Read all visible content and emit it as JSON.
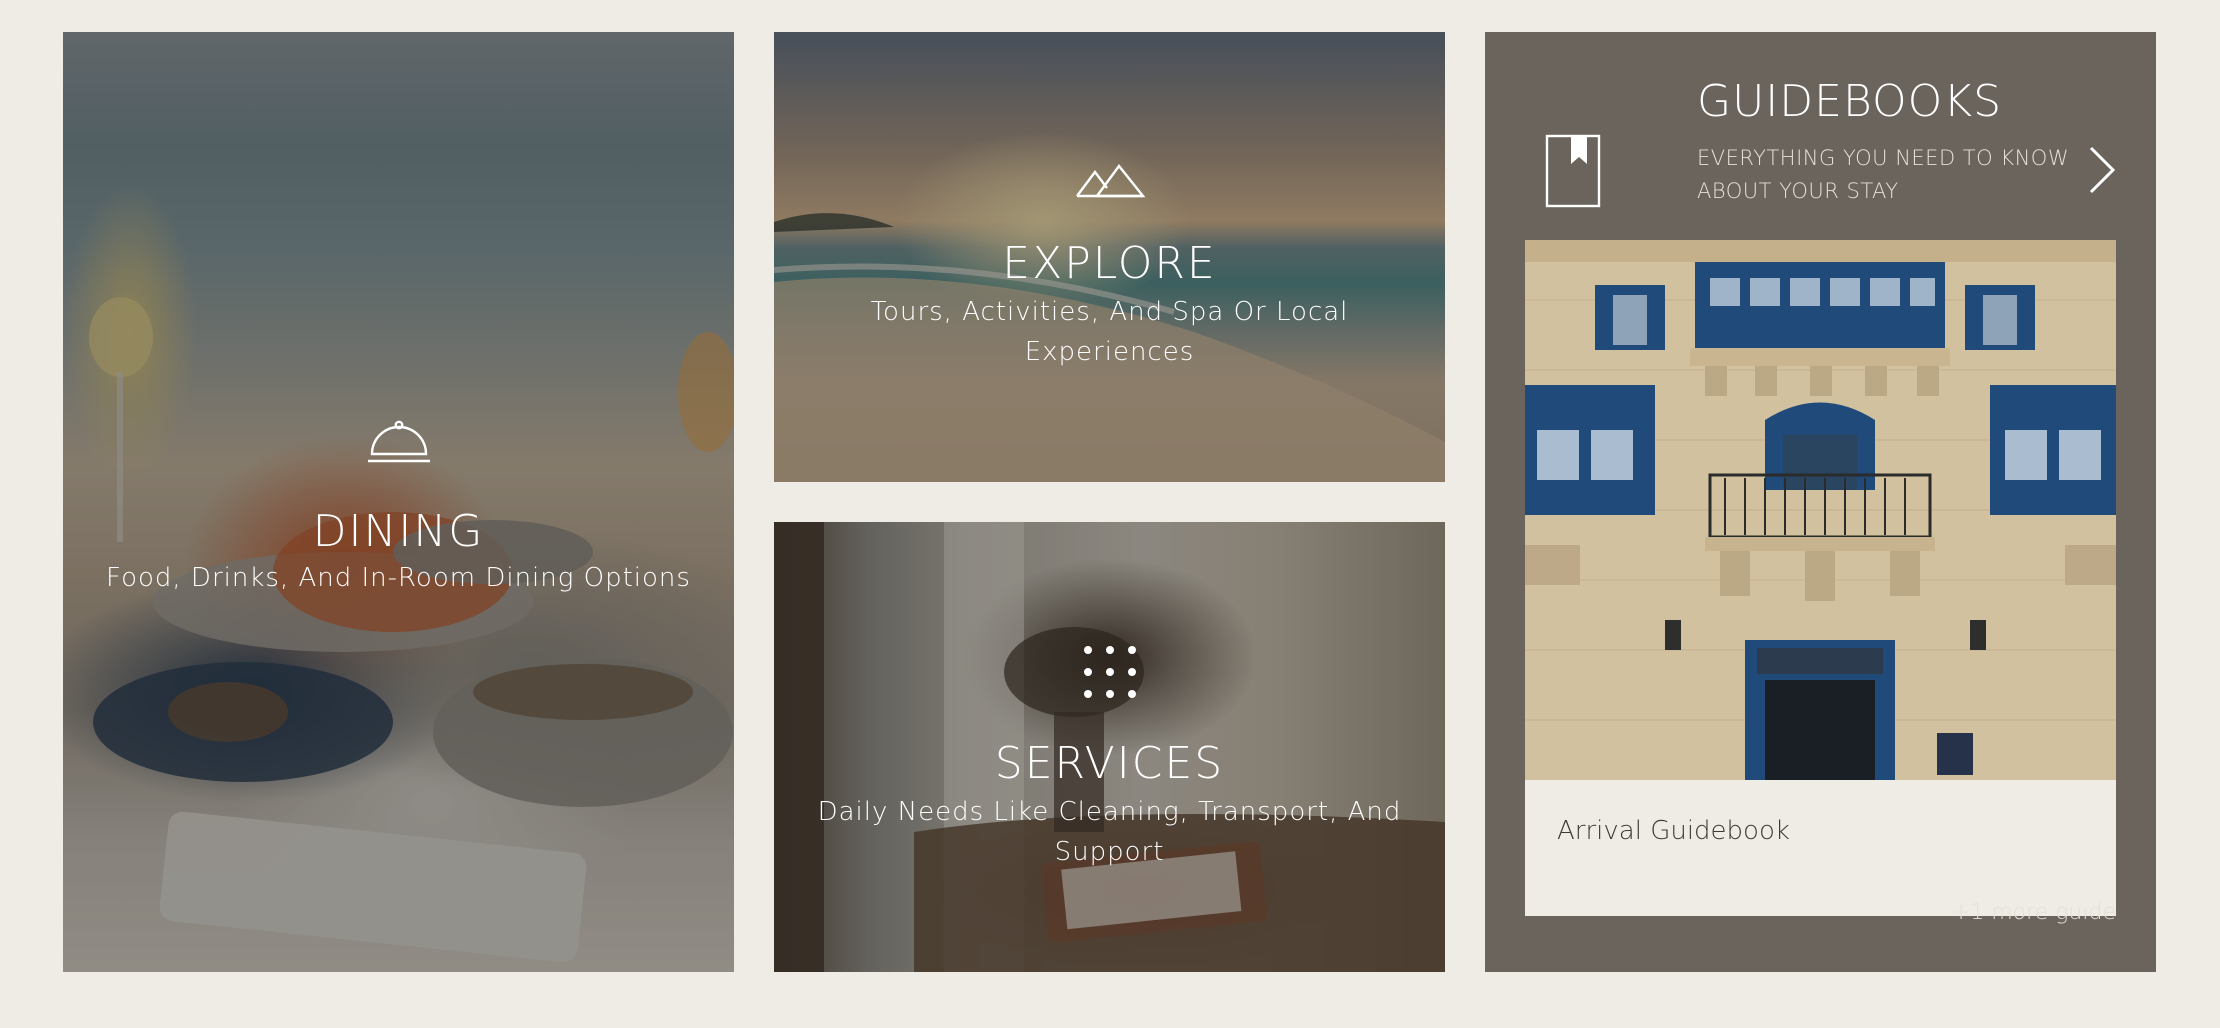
{
  "tiles": {
    "dining": {
      "icon": "cloche-icon",
      "title": "DINING",
      "subtitle": "Food, Drinks, And In-Room Dining Options"
    },
    "explore": {
      "icon": "mountains-icon",
      "title": "EXPLORE",
      "subtitle_line1": "Tours, Activities, And Spa Or Local",
      "subtitle_line2": "Experiences"
    },
    "services": {
      "icon": "dots-grid-icon",
      "title": "SERVICES",
      "subtitle_line1": "Daily Needs Like Cleaning, Transport, And",
      "subtitle_line2": "Support"
    }
  },
  "guidebooks": {
    "icon": "bookmark-book-icon",
    "title": "GUIDEBOOKS",
    "subtitle_line1": "EVERYTHING YOU NEED TO KNOW",
    "subtitle_line2": "ABOUT YOUR STAY",
    "next_icon": "chevron-right-icon",
    "card": {
      "label": "Arrival Guidebook",
      "image": "building-facade-photo"
    },
    "more_link": "+1 more guide"
  },
  "colors": {
    "page_background": "#efece6",
    "guidebook_panel": "#6a645c",
    "card_background": "#efece6",
    "shutter_blue": "#1f4a7a",
    "text_light": "#ffffff"
  }
}
